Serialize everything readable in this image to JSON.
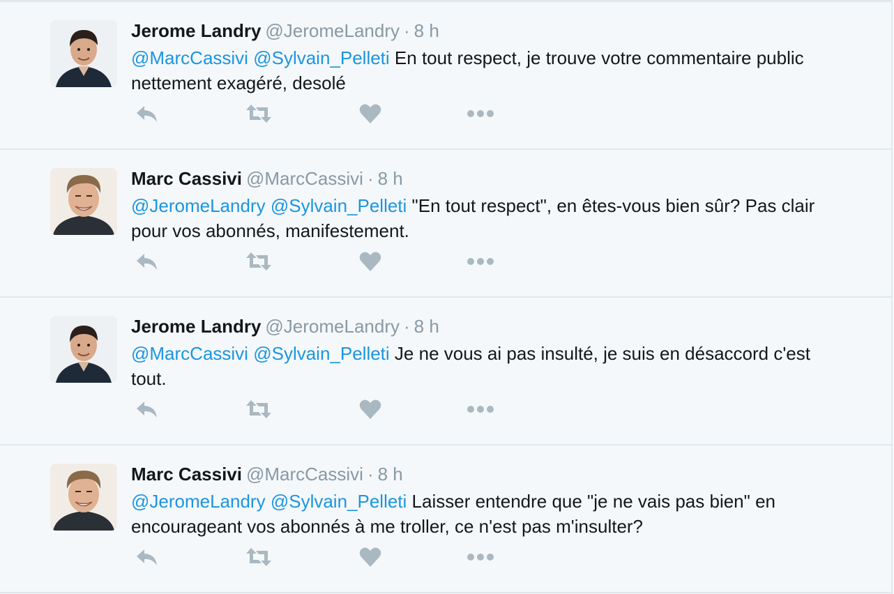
{
  "colors": {
    "background": "#f5f8fa",
    "mention": "#1b95e0",
    "secondary_text": "#8899a6",
    "icon": "#aab8c2",
    "divider": "#e1e8ed"
  },
  "tweets": [
    {
      "fullname": "Jerome Landry",
      "username": "@JeromeLandry",
      "separator": "·",
      "time": "8 h",
      "avatar": "avatar-jerome-landry",
      "mentions": [
        "@MarcCassivi",
        "@Sylvain_Pelleti"
      ],
      "body": "En tout respect, je trouve votre commentaire public nettement exagéré, desolé"
    },
    {
      "fullname": "Marc Cassivi",
      "username": "@MarcCassivi",
      "separator": "·",
      "time": "8 h",
      "avatar": "avatar-marc-cassivi",
      "mentions": [
        "@JeromeLandry",
        "@Sylvain_Pelleti"
      ],
      "body": "\"En tout respect\", en êtes-vous bien sûr? Pas clair pour vos abonnés, manifestement."
    },
    {
      "fullname": "Jerome Landry",
      "username": "@JeromeLandry",
      "separator": "·",
      "time": "8 h",
      "avatar": "avatar-jerome-landry",
      "mentions": [
        "@MarcCassivi",
        "@Sylvain_Pelleti"
      ],
      "body": "Je ne vous ai pas insulté, je suis en désaccord c'est tout."
    },
    {
      "fullname": "Marc Cassivi",
      "username": "@MarcCassivi",
      "separator": "·",
      "time": "8 h",
      "avatar": "avatar-marc-cassivi",
      "mentions": [
        "@JeromeLandry",
        "@Sylvain_Pelleti"
      ],
      "body": "Laisser entendre que \"je ne vais pas bien\" en encourageant vos abonnés à me troller, ce n'est pas m'insulter?"
    }
  ],
  "action_icons": [
    "reply-icon",
    "retweet-icon",
    "like-icon",
    "more-icon"
  ]
}
